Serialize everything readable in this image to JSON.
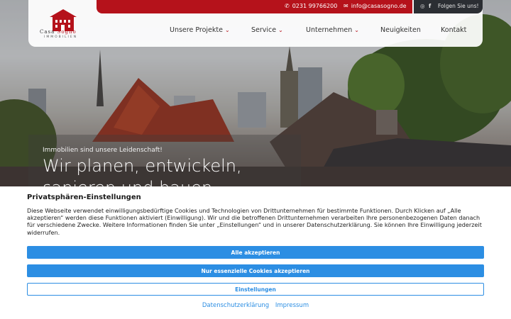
{
  "header": {
    "phone": "0231 99766200",
    "email": "info@casasogno.de",
    "social_label": "Folgen Sie uns!",
    "logo": {
      "word1": "Casa",
      "word2": "Sogno",
      "sub": "IMMOBILIEN"
    },
    "nav": [
      {
        "label": "Unsere Projekte",
        "has_dropdown": true
      },
      {
        "label": "Service",
        "has_dropdown": true
      },
      {
        "label": "Unternehmen",
        "has_dropdown": true
      },
      {
        "label": "Neuigkeiten",
        "has_dropdown": false
      },
      {
        "label": "Kontakt",
        "has_dropdown": false
      }
    ],
    "colors": {
      "brand_red": "#b5121b",
      "dark": "#2b2e33"
    }
  },
  "hero": {
    "tagline": "Immobilien sind unsere Leidenschaft!",
    "title": "Wir planen, entwickeln, sanieren und bauen"
  },
  "cookie": {
    "title": "Privatsphären-Einstellungen",
    "text": "Diese Webseite verwendet einwilligungsbedürftige Cookies und Technologien von Drittunternehmen für bestimmte Funktionen. Durch Klicken auf „Alle akzeptie­ren“ werden diese Funktionen aktiviert (Einwilligung). Wir und die betroffenen Drittunternehmen verarbeiten Ihre personenbezogenen Daten danach für ver­schiedene Zwecke. Weitere Informationen finden Sie unter „Einstellungen“ und in unserer Datenschutzerklärung. Sie können Ihre Einwilligung jederzeit widerrufen.",
    "accept_all": "Alle akzeptieren",
    "accept_essential": "Nur essenzielle Cookies akzeptieren",
    "settings": "Einstellungen",
    "privacy_link": "Datenschutzerklärung",
    "imprint_link": "Impressum",
    "accent": "#2c8ee3"
  }
}
